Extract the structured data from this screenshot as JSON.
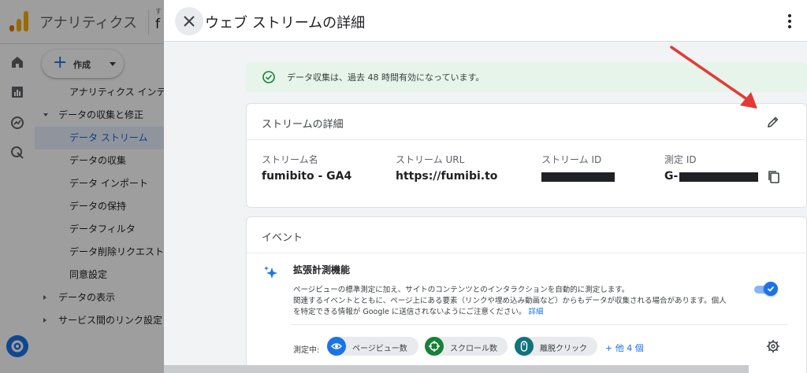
{
  "background": {
    "app_name": "アナリティクス",
    "account_small": "す",
    "account_big": "f",
    "create_label": "作成",
    "nav": [
      {
        "label": "アナリティクス インテリ",
        "indent": 44,
        "caret": "",
        "active": false
      },
      {
        "label": "データの収集と修正",
        "indent": 30,
        "caret": "down",
        "active": false
      },
      {
        "label": "データ ストリーム",
        "indent": 44,
        "caret": "",
        "active": true
      },
      {
        "label": "データの収集",
        "indent": 44,
        "caret": "",
        "active": false
      },
      {
        "label": "データ インポート",
        "indent": 44,
        "caret": "",
        "active": false
      },
      {
        "label": "データの保持",
        "indent": 44,
        "caret": "",
        "active": false
      },
      {
        "label": "データフィルタ",
        "indent": 44,
        "caret": "",
        "active": false
      },
      {
        "label": "データ削除リクエスト",
        "indent": 44,
        "caret": "",
        "active": false
      },
      {
        "label": "同意設定",
        "indent": 44,
        "caret": "",
        "active": false
      },
      {
        "label": "データの表示",
        "indent": 30,
        "caret": "right",
        "active": false
      },
      {
        "label": "サービス間のリンク設定",
        "indent": 30,
        "caret": "right",
        "active": false
      }
    ]
  },
  "panel": {
    "title": "ウェブ ストリームの詳細",
    "alert": "データ収集は、過去 48 時間有効になっています。",
    "stream_card": {
      "title": "ストリームの詳細",
      "fields": [
        {
          "label": "ストリーム名",
          "value": "fumibito - GA4"
        },
        {
          "label": "ストリーム URL",
          "value": "https://fumibi.to"
        },
        {
          "label": "ストリーム ID",
          "value": ""
        },
        {
          "label": "測定 ID",
          "value": "G-"
        }
      ]
    },
    "events_card": {
      "title": "イベント",
      "enhanced_title": "拡張計測機能",
      "description_line1": "ページビューの標準測定に加え、サイトのコンテンツとのインタラクションを自動的に測定します。",
      "description_line2": "関連するイベントとともに、ページ上にある要素（リンクや埋め込み動画など）からもデータが収集される場合があります。個人",
      "description_line3": "を特定できる情報が Google に送信されないようにご注意ください。",
      "link": "詳細",
      "toggle_on": true,
      "measuring_label": "測定中:",
      "chips": [
        {
          "label": "ページビュー数",
          "icon": "eye-icon",
          "color": "#1a73e8"
        },
        {
          "label": "スクロール数",
          "icon": "scroll-target-icon",
          "color": "#188038"
        },
        {
          "label": "離脱クリック",
          "icon": "mouse-icon",
          "color": "#12727a"
        }
      ],
      "more": "+ 他 4 個"
    }
  },
  "colors": {
    "accent": "#1a73e8",
    "alert_bg": "#e6f4ea",
    "alert_icon": "#188038",
    "annotation_arrow": "#e53935"
  }
}
